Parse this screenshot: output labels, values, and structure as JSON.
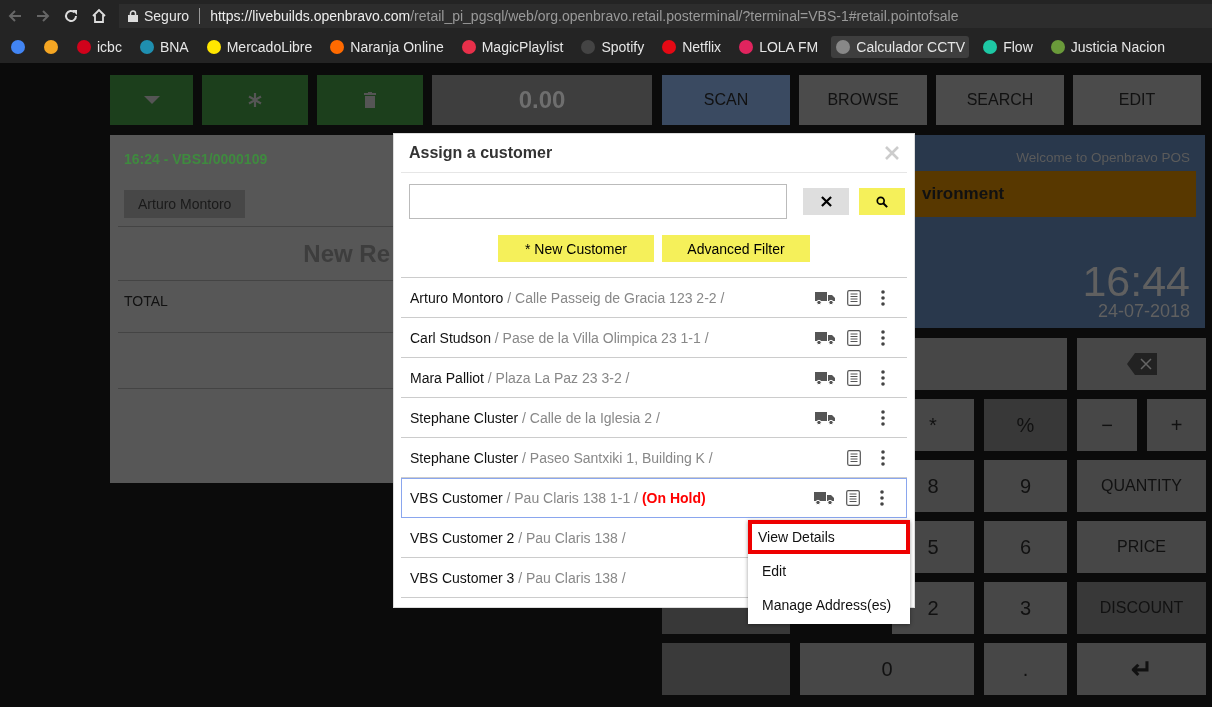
{
  "browser": {
    "security_label": "Seguro",
    "url_host": "https://livebuilds.openbravo.com",
    "url_path": "/retail_pi_pgsql/web/org.openbravo.retail.posterminal/?terminal=VBS-1#retail.pointofsale",
    "bookmarks": [
      {
        "color": "#4285f4",
        "highlighted": false
      },
      {
        "color": "#f5a623",
        "highlighted": false
      },
      {
        "label": "icbc",
        "color": "#d0021b",
        "highlighted": false
      },
      {
        "label": "BNA",
        "color": "#1f8fb0",
        "highlighted": false
      },
      {
        "label": "MercadoLibre",
        "color": "#ffe600",
        "highlighted": false
      },
      {
        "label": "Naranja Online",
        "color": "#ff6a00",
        "highlighted": false
      },
      {
        "label": "MagicPlaylist",
        "color": "#e8304a",
        "highlighted": false
      },
      {
        "label": "Spotify",
        "color": "#444444",
        "highlighted": false
      },
      {
        "label": "Netflix",
        "color": "#e50914",
        "highlighted": false
      },
      {
        "label": "LOLA FM",
        "color": "#e0245e",
        "highlighted": false
      },
      {
        "label": "Calculador CCTV",
        "color": "#888888",
        "highlighted": true
      },
      {
        "label": "Flow",
        "color": "#1ec8a5",
        "highlighted": false
      },
      {
        "label": "Justicia Nacion",
        "color": "#6a9a3a",
        "highlighted": false
      }
    ]
  },
  "toolbar": {
    "total": "0.00",
    "buttons": [
      "SCAN",
      "BROWSE",
      "SEARCH",
      "EDIT"
    ]
  },
  "receipt": {
    "header": "16:24 - VBS1/0000109",
    "customer": "Arturo Montoro",
    "title": "New Re",
    "total_label": "TOTAL"
  },
  "info_panel": {
    "welcome": "Welcome to Openbravo POS",
    "banner": "vironment",
    "time": "16:44",
    "date": "24-07-2018"
  },
  "keypad": [
    {
      "kind": "backspace"
    },
    {
      "label": "*",
      "kind": "key"
    },
    {
      "label": "%",
      "kind": "dark"
    },
    {
      "label": "−",
      "kind": "key"
    },
    {
      "label": "+",
      "kind": "key"
    },
    {
      "label": "8",
      "kind": "key"
    },
    {
      "label": "9",
      "kind": "key"
    },
    {
      "label": "QUANTITY",
      "kind": "key"
    },
    {
      "label": "5",
      "kind": "key"
    },
    {
      "label": "6",
      "kind": "key"
    },
    {
      "label": "PRICE",
      "kind": "key"
    },
    {
      "label": "2",
      "kind": "key"
    },
    {
      "label": "3",
      "kind": "key"
    },
    {
      "label": "DISCOUNT",
      "kind": "dark"
    },
    {
      "label": "0",
      "kind": "key"
    },
    {
      "label": ".",
      "kind": "key"
    },
    {
      "label": "↵",
      "kind": "key"
    }
  ],
  "dialog": {
    "title": "Assign a customer",
    "actions": [
      "* New Customer",
      "Advanced Filter"
    ],
    "customers": [
      {
        "name": "Arturo Montoro",
        "address": "/ Calle Passeig de Gracia 123 2-2 /",
        "selected": false,
        "truck": true,
        "document": true,
        "menu_button": true
      },
      {
        "name": "Carl Studson",
        "address": "/ Pase de la Villa Olimpica 23 1-1 /",
        "selected": false,
        "truck": true,
        "document": true,
        "menu_button": true
      },
      {
        "name": "Mara Palliot",
        "address": "/ Plaza La Paz 23 3-2 /",
        "selected": false,
        "truck": true,
        "document": true,
        "menu_button": true
      },
      {
        "name": "Stephane Cluster",
        "address": "/ Calle de la Iglesia 2 /",
        "selected": false,
        "truck": true,
        "document": false,
        "menu_button": true
      },
      {
        "name": "Stephane Cluster",
        "address": "/ Paseo Santxiki 1, Building K /",
        "selected": false,
        "truck": false,
        "document": true,
        "menu_button": true
      },
      {
        "name": "VBS Customer",
        "address": "/ Pau Claris 138 1-1 /",
        "status": "(On Hold)",
        "selected": true,
        "truck": true,
        "document": true,
        "menu_button": true
      },
      {
        "name": "VBS Customer 2",
        "address": "/ Pau Claris 138 /",
        "selected": false
      },
      {
        "name": "VBS Customer 3",
        "address": "/ Pau Claris 138 /",
        "selected": false
      }
    ],
    "context_menu": [
      {
        "label": "View Details",
        "selected": true
      },
      {
        "label": "Edit",
        "selected": false
      },
      {
        "label": "Manage Address(es)",
        "selected": false
      }
    ]
  }
}
